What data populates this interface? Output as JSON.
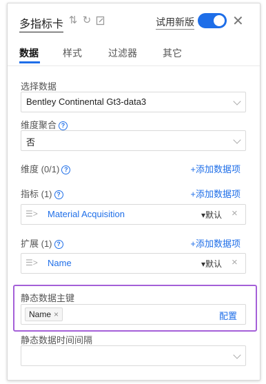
{
  "header": {
    "title": "多指标卡",
    "sort_icon": "sort-arrows-icon",
    "refresh_icon": "refresh-icon",
    "edit_icon": "edit-icon",
    "trial_label": "试用新版",
    "toggle_on": true,
    "close_icon": "close-icon",
    "accent_color": "#1e6ee8"
  },
  "tabs": [
    "数据",
    "样式",
    "过滤器",
    "其它"
  ],
  "active_tab": "数据",
  "data_select": {
    "label": "选择数据",
    "value": "Bentley Continental Gt3-data3"
  },
  "dim_agg": {
    "label": "维度聚合",
    "value": "否"
  },
  "dimension": {
    "label": "维度 (0/1)",
    "add_label": "+添加数据项"
  },
  "metric": {
    "label": "指标 (1)",
    "add_label": "+添加数据项",
    "item": {
      "name": "Material Acquisition",
      "dropdown": "▾默认"
    }
  },
  "extension": {
    "label": "扩展 (1)",
    "add_label": "+添加数据项",
    "item": {
      "name": "Name",
      "dropdown": "▾默认"
    }
  },
  "static_key": {
    "label": "静态数据主键",
    "tag": "Name",
    "config_label": "配置",
    "highlight_color": "#a45fd8"
  },
  "static_interval": {
    "label": "静态数据时间间隔",
    "value": ""
  }
}
